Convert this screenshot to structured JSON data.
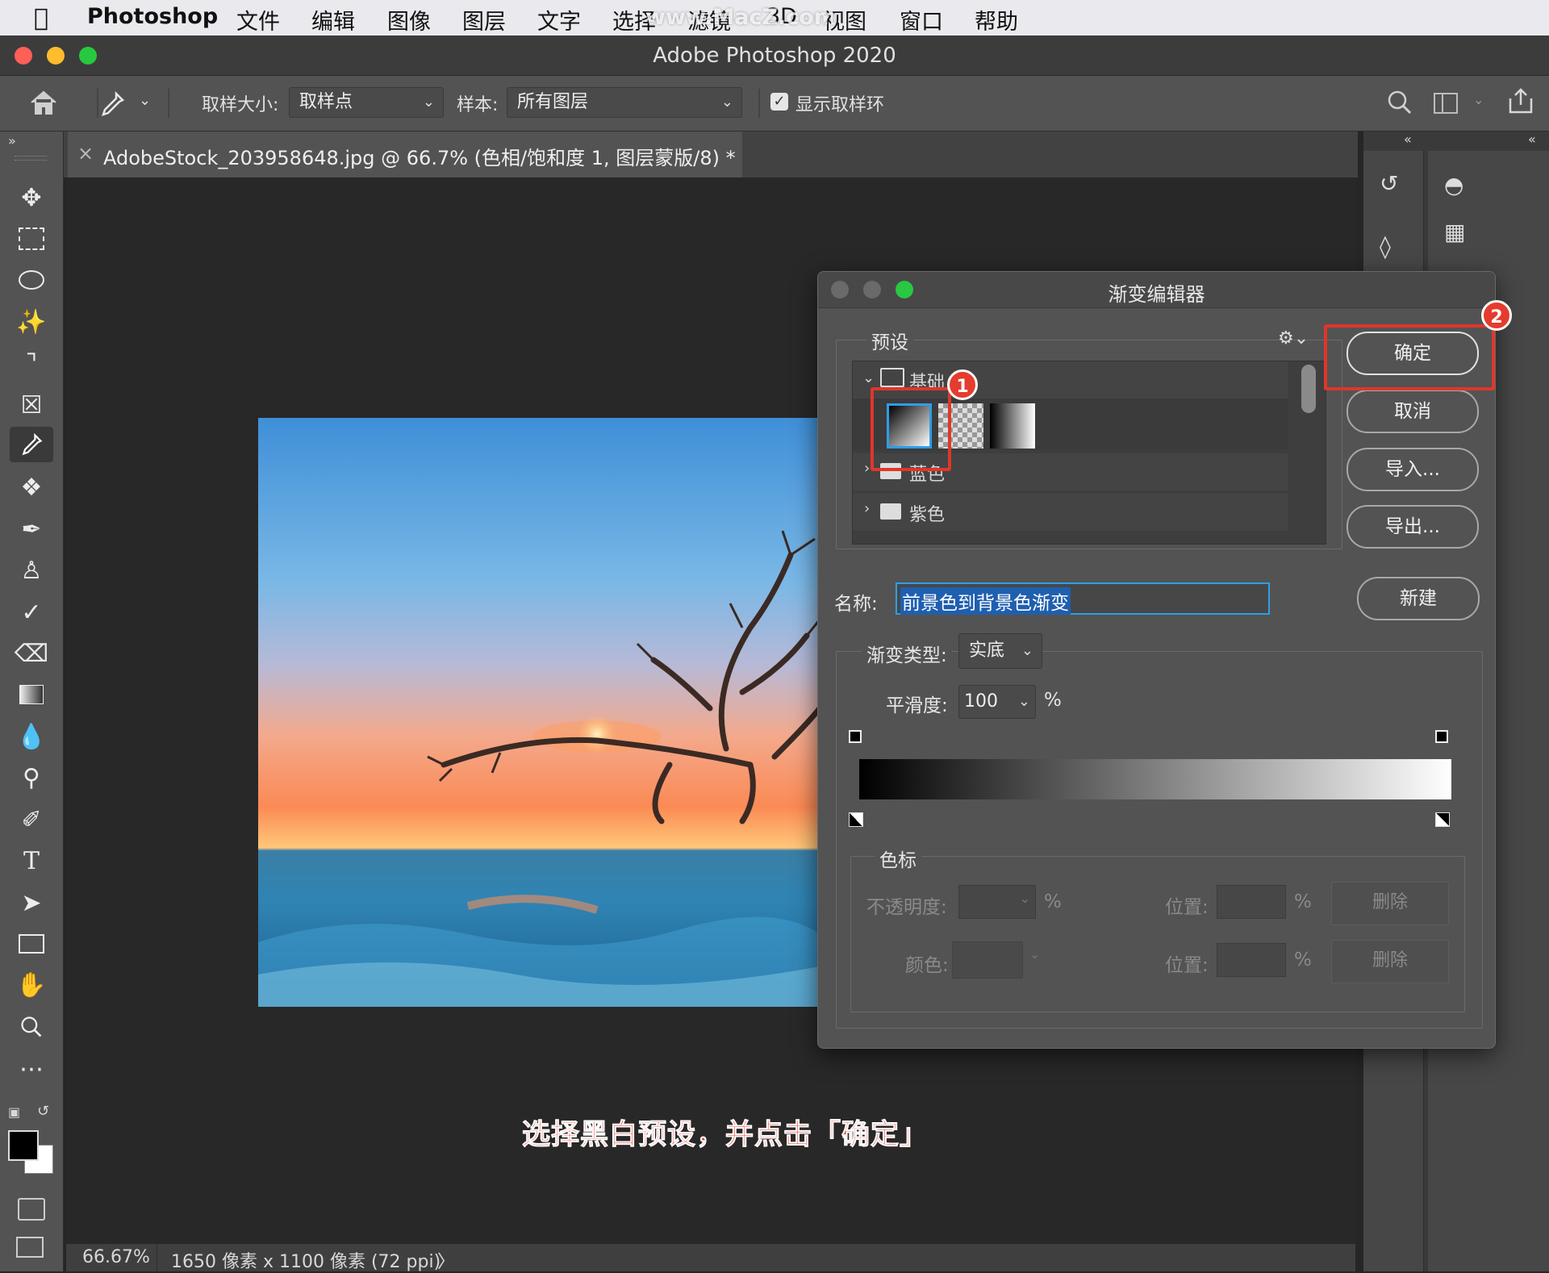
{
  "menubar": {
    "app_name": "Photoshop",
    "items": [
      "文件",
      "编辑",
      "图像",
      "图层",
      "文字",
      "选择",
      "滤镜",
      "3D",
      "视图",
      "窗口",
      "帮助"
    ],
    "watermark": "www.MacZ.com"
  },
  "window": {
    "title": "Adobe Photoshop 2020"
  },
  "options_bar": {
    "sample_size_label": "取样大小:",
    "sample_size_value": "取样点",
    "sample_label": "样本:",
    "sample_value": "所有图层",
    "show_ring_label": "显示取样环",
    "show_ring_checked": true
  },
  "document": {
    "tab_title": "AdobeStock_203958648.jpg @ 66.7% (色相/饱和度 1, 图层蒙版/8) *",
    "close_glyph": "×"
  },
  "status_bar": {
    "zoom": "66.67%",
    "dimensions": "1650 像素 x 1100 像素 (72 ppi)",
    "arrow": "〉"
  },
  "gradient_editor": {
    "title": "渐变编辑器",
    "presets_label": "预设",
    "folders": [
      {
        "name": "基础",
        "expanded": true
      },
      {
        "name": "蓝色",
        "expanded": false
      },
      {
        "name": "紫色",
        "expanded": false
      }
    ],
    "buttons": {
      "ok": "确定",
      "cancel": "取消",
      "import": "导入...",
      "export": "导出...",
      "new": "新建"
    },
    "name_label": "名称:",
    "name_value": "前景色到背景色渐变",
    "type_label": "渐变类型:",
    "type_value": "实底",
    "smoothness_label": "平滑度:",
    "smoothness_value": "100",
    "percent": "%",
    "stops_group_label": "色标",
    "opacity_label": "不透明度:",
    "location_label": "位置:",
    "color_label": "颜色:",
    "delete_label": "删除"
  },
  "annotations": {
    "badge_1": "1",
    "badge_2": "2",
    "caption": "选择黑白预设，并点击「确定」"
  },
  "colors": {
    "highlight_red": "#e0362c",
    "selection_blue": "#2d9ee8",
    "panel_bg": "#535353"
  }
}
